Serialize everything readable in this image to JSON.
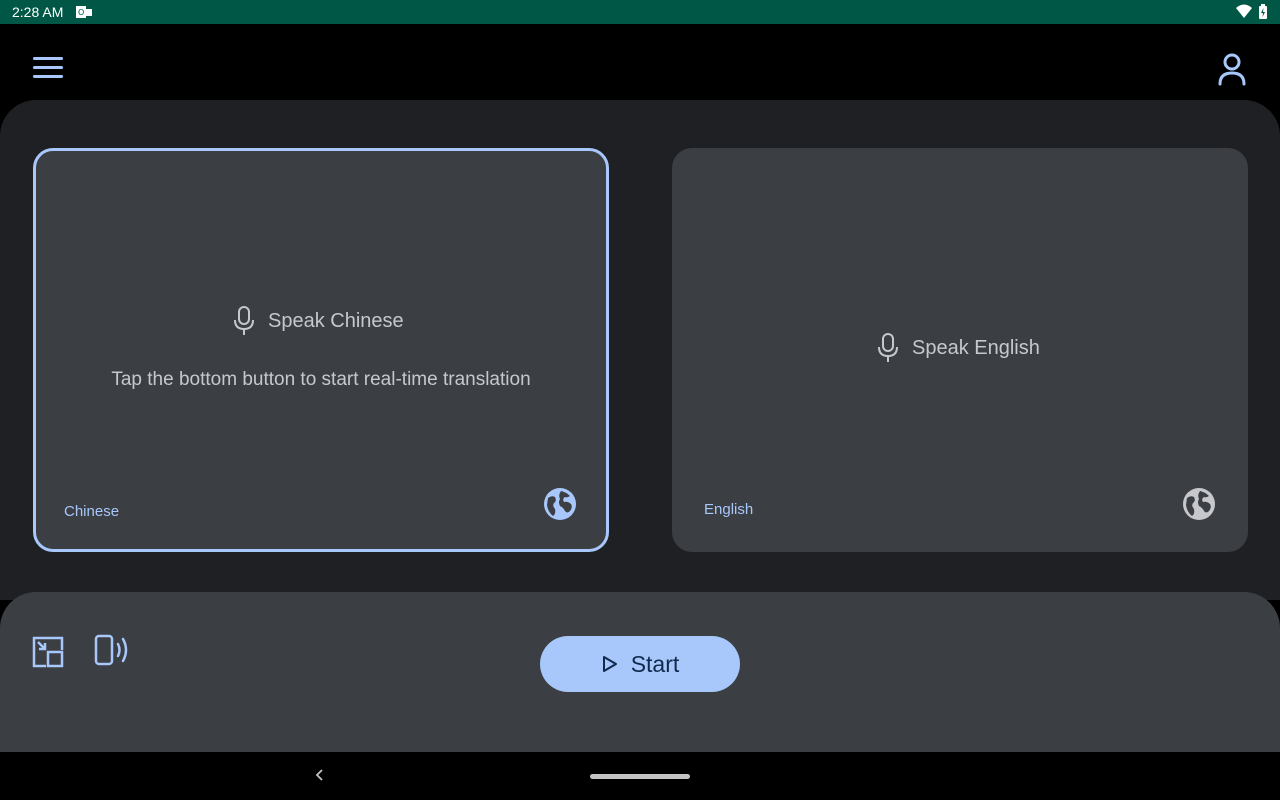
{
  "status_bar": {
    "time": "2:28 AM",
    "icons": [
      "notification-icon",
      "wifi-icon",
      "battery-icon"
    ]
  },
  "app_bar": {
    "icons": [
      "menu-icon",
      "account-icon"
    ]
  },
  "panels": {
    "source": {
      "prompt": "Speak Chinese",
      "hint": "Tap the bottom button to start real-time translation",
      "language": "Chinese",
      "icon": "globe-icon"
    },
    "target": {
      "prompt": "Speak English",
      "language": "English",
      "icon": "globe-icon"
    }
  },
  "controls": {
    "start_label": "Start",
    "icons": [
      "picture-in-picture-icon",
      "speaker-phone-icon",
      "play-icon"
    ]
  },
  "colors": {
    "status_bar": "#005746",
    "background": "#000000",
    "surface": "#1f2024",
    "panel": "#3b3e42",
    "accent": "#a8c7fa",
    "text": "#c6c8cc"
  }
}
